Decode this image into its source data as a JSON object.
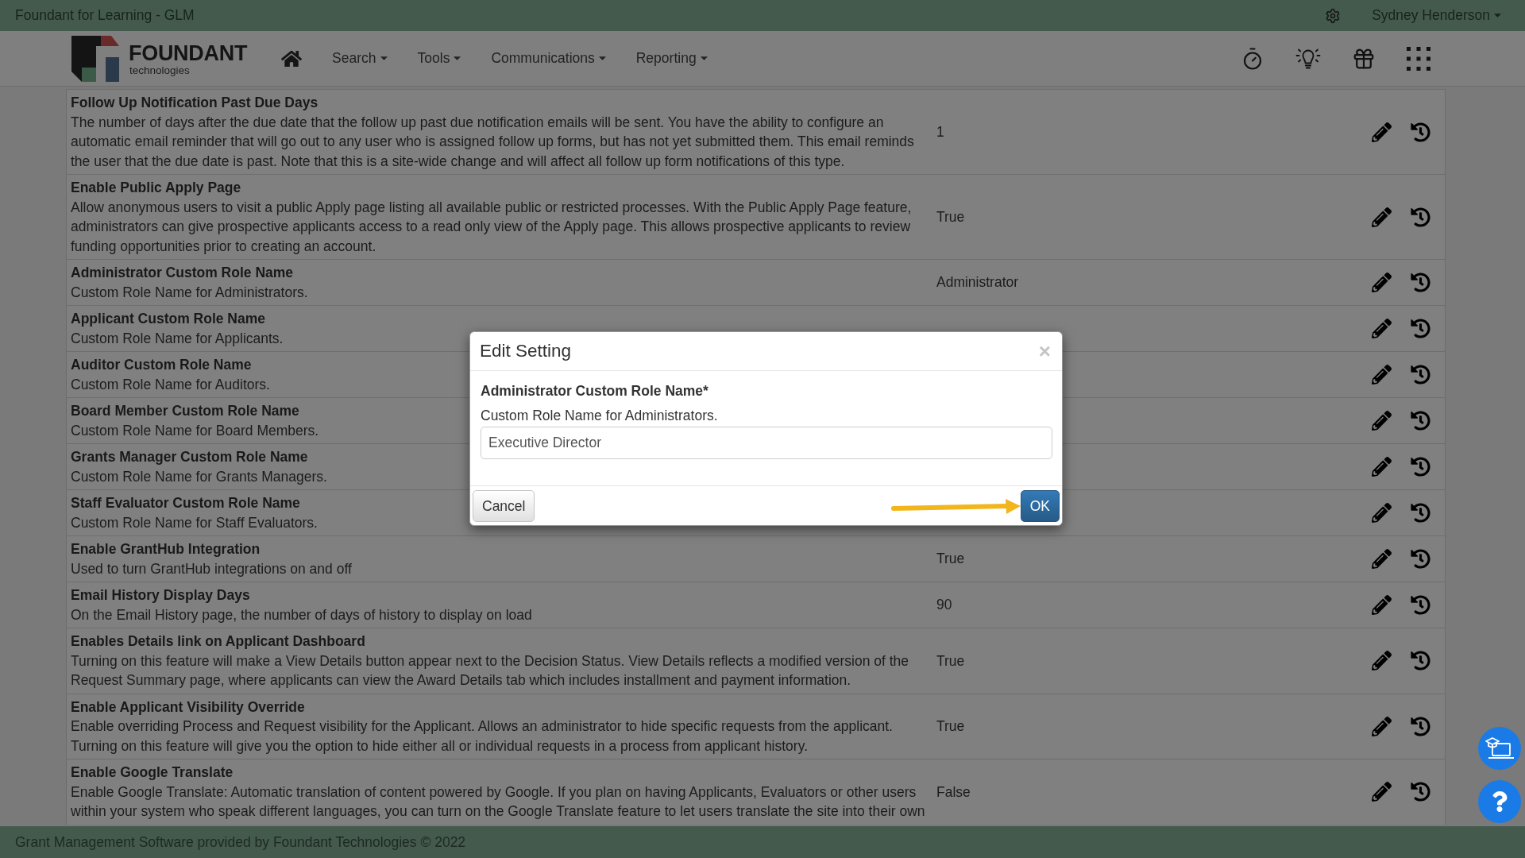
{
  "window": {
    "title": "Foundant for Learning - GLM"
  },
  "user_menu": {
    "label": "Sydney Henderson",
    "dropdown": true
  },
  "logo": {
    "name": "FOUNDANT",
    "tagline": "technologies"
  },
  "nav": {
    "menus": [
      {
        "label": "Search",
        "dropdown": true
      },
      {
        "label": "Tools",
        "dropdown": true
      },
      {
        "label": "Communications",
        "dropdown": true
      },
      {
        "label": "Reporting",
        "dropdown": true
      }
    ]
  },
  "settings": [
    {
      "title": "Follow Up Notification Past Due Days",
      "description": "The number of days after the due date that the follow up past due notification emails will be sent. You have the ability to configure an automatic email reminder that will go out to any user who is assigned follow up forms, but has not yet submitted them. This email reminds the user that the due date is past. Note that this is a site-wide change and will affect all follow up form notifications of this type.",
      "value": "1"
    },
    {
      "title": "Enable Public Apply Page",
      "description": "Allow anonymous users to visit a public Apply page listing all available public or restricted processes. With the Public Apply Page feature, administrators can give prospective applicants access to a read only view of the Apply page. This allows prospective applicants to review funding opportunities prior to creating an account.",
      "value": "True"
    },
    {
      "title": "Administrator Custom Role Name",
      "description": "Custom Role Name for Administrators.",
      "value": "Administrator"
    },
    {
      "title": "Applicant Custom Role Name",
      "description": "Custom Role Name for Applicants."
    },
    {
      "title": "Auditor Custom Role Name",
      "description": "Custom Role Name for Auditors."
    },
    {
      "title": "Board Member Custom Role Name",
      "description": "Custom Role Name for Board Members."
    },
    {
      "title": "Grants Manager Custom Role Name",
      "description": "Custom Role Name for Grants Managers."
    },
    {
      "title": "Staff Evaluator Custom Role Name",
      "description": "Custom Role Name for Staff Evaluators."
    },
    {
      "title": "Enable GrantHub Integration",
      "description": "Used to turn GrantHub integrations on and off",
      "value": "True"
    },
    {
      "title": "Email History Display Days",
      "description": "On the Email History page, the number of days of history to display on load",
      "value": "90"
    },
    {
      "title": "Enables Details link on Applicant Dashboard",
      "description": "Turning on this feature will make a View Details button appear next to the Decision Status. View Details reflects a modified version of the Request Summary page, where applicants can view the Award Details tab which includes installment and payment information.",
      "value": "True"
    },
    {
      "title": "Enable Applicant Visibility Override",
      "description": "Enable overriding Process and Request visibility for the Applicant. Allows an administrator to hide specific requests from the applicant. Turning on this feature will give you the option to hide either all or individual requests in a process from applicant history.",
      "value": "True"
    },
    {
      "title": "Enable Google Translate",
      "description": "Enable Google Translate: Automatic translation of content powered by Google. If you plan on having Applicants, Evaluators or other users within your system who speak different languages, you can turn on the Google Translate feature to let users translate the site into their own",
      "value": "False"
    }
  ],
  "dialog": {
    "title": "Edit Setting",
    "close": "×",
    "field_label": "Administrator Custom Role Name*",
    "help": "Custom Role Name for Administrators.",
    "value": "Executive Director",
    "buttons": [
      {
        "label": "Cancel",
        "kind": "default"
      },
      {
        "label": "OK",
        "kind": "primary"
      }
    ]
  },
  "footer": {
    "text": "Grant Management Software provided by Foundant Technologies © 2022"
  }
}
